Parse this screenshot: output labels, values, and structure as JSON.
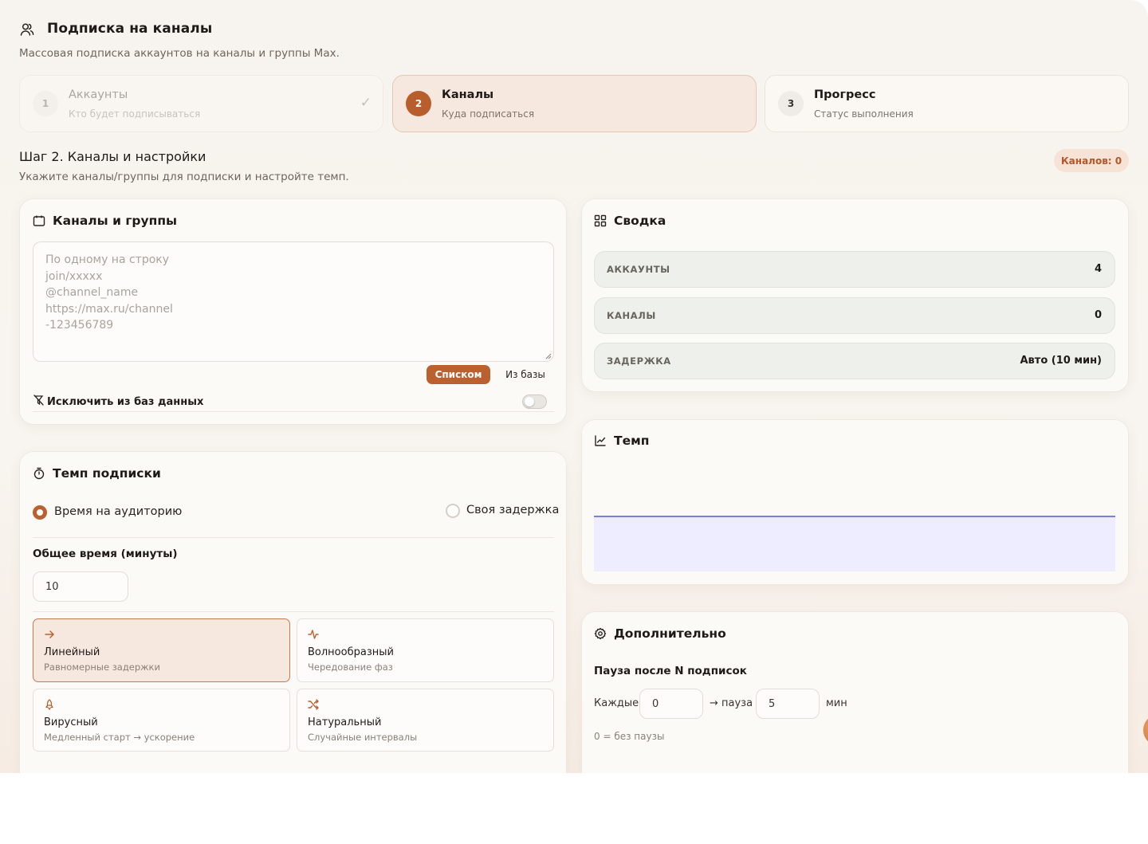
{
  "header": {
    "title": "Подписка на каналы",
    "subtitle": "Массовая подписка аккаунтов на каналы и группы Max."
  },
  "steps": [
    {
      "num": "1",
      "title": "Аккаунты",
      "subtitle": "Кто будет подписываться",
      "state": "done"
    },
    {
      "num": "2",
      "title": "Каналы",
      "subtitle": "Куда подписаться",
      "state": "active"
    },
    {
      "num": "3",
      "title": "Прогресс",
      "subtitle": "Статус выполнения",
      "state": "pending"
    }
  ],
  "section": {
    "title": "Шаг 2. Каналы и настройки",
    "subtitle": "Укажите каналы/группы для подписки и настройте темп.",
    "badge": "Каналов: 0"
  },
  "channels": {
    "title": "Каналы и группы",
    "placeholder": "По одному на строку\njoin/xxxxx\n@channel_name\nhttps://max.ru/channel\n-123456789",
    "btn_list": "Списком",
    "btn_base": "Из базы",
    "exclude_label": "Исключить из баз данных",
    "exclude_enabled": false
  },
  "pace": {
    "title": "Темп подписки",
    "option_audience": "Время на аудиторию",
    "option_custom": "Своя задержка",
    "selected": "audience",
    "total_label": "Общее время (минуты)",
    "total_value": "10",
    "modes": [
      {
        "icon": "arrow-right-icon",
        "title": "Линейный",
        "subtitle": "Равномерные задержки",
        "selected": true
      },
      {
        "icon": "pulse-icon",
        "title": "Волнообразный",
        "subtitle": "Чередование фаз",
        "selected": false
      },
      {
        "icon": "rocket-icon",
        "title": "Вирусный",
        "subtitle": "Медленный старт → ускорение",
        "selected": false
      },
      {
        "icon": "shuffle-icon",
        "title": "Натуральный",
        "subtitle": "Случайные интервалы",
        "selected": false
      }
    ]
  },
  "summary": {
    "title": "Сводка",
    "rows": [
      {
        "label": "АККАУНТЫ",
        "value": "4"
      },
      {
        "label": "КАНАЛЫ",
        "value": "0"
      },
      {
        "label": "ЗАДЕРЖКА",
        "value": "Авто (10 мин)"
      }
    ]
  },
  "tempo_chart": {
    "title": "Темп"
  },
  "chart_data": {
    "type": "area",
    "x": [
      0,
      1
    ],
    "values": [
      1,
      1
    ],
    "title": "",
    "xlabel": "",
    "ylabel": "",
    "grid": false,
    "colors": {
      "line": "#7b7fd6",
      "fill": "#eeedff"
    }
  },
  "extra": {
    "title": "Дополнительно",
    "pause_label": "Пауза после N подписок",
    "every_label": "Каждые",
    "every_value": "0",
    "pause_word": "→ пауза",
    "pause_value": "5",
    "unit": "мин",
    "hint": "0 = без паузы"
  },
  "colors": {
    "accent": "#bb602f",
    "accent_soft": "#f6e8de"
  }
}
